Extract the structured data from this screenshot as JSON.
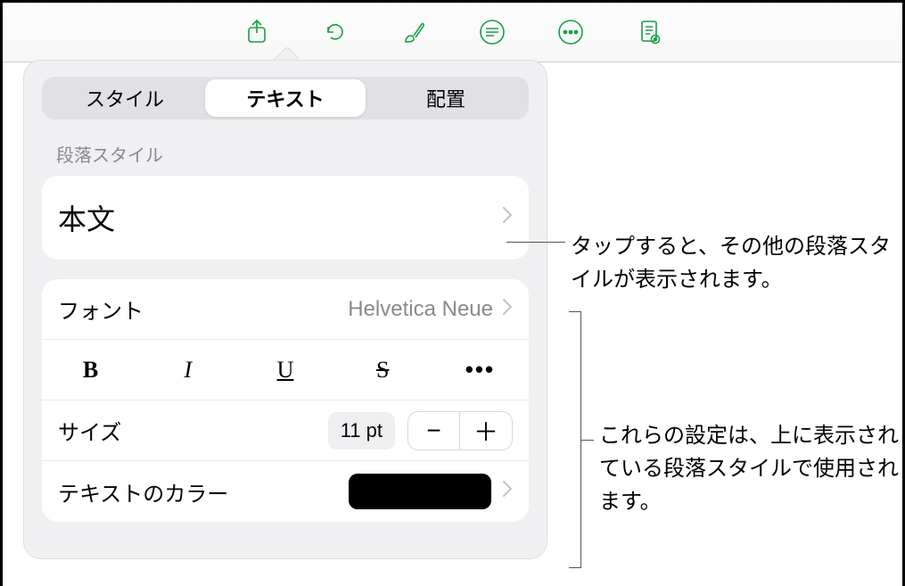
{
  "toolbar": {
    "icons": [
      "share-icon",
      "undo-icon",
      "brush-icon",
      "insert-icon",
      "more-icon",
      "document-icon"
    ]
  },
  "tabs": {
    "style": "スタイル",
    "text": "テキスト",
    "layout": "配置"
  },
  "paragraph": {
    "section_label": "段落スタイル",
    "current": "本文"
  },
  "font": {
    "label": "フォント",
    "value": "Helvetica Neue"
  },
  "format": {
    "bold": "B",
    "italic": "I",
    "underline": "U",
    "strike": "S",
    "more": "•••"
  },
  "size": {
    "label": "サイズ",
    "value": "11 pt",
    "minus": "−",
    "plus": "＋"
  },
  "color": {
    "label": "テキストのカラー"
  },
  "callouts": {
    "c1": "タップすると、その他の段落スタイルが表示されます。",
    "c2": "これらの設定は、上に表示されている段落スタイルで使用されます。"
  }
}
